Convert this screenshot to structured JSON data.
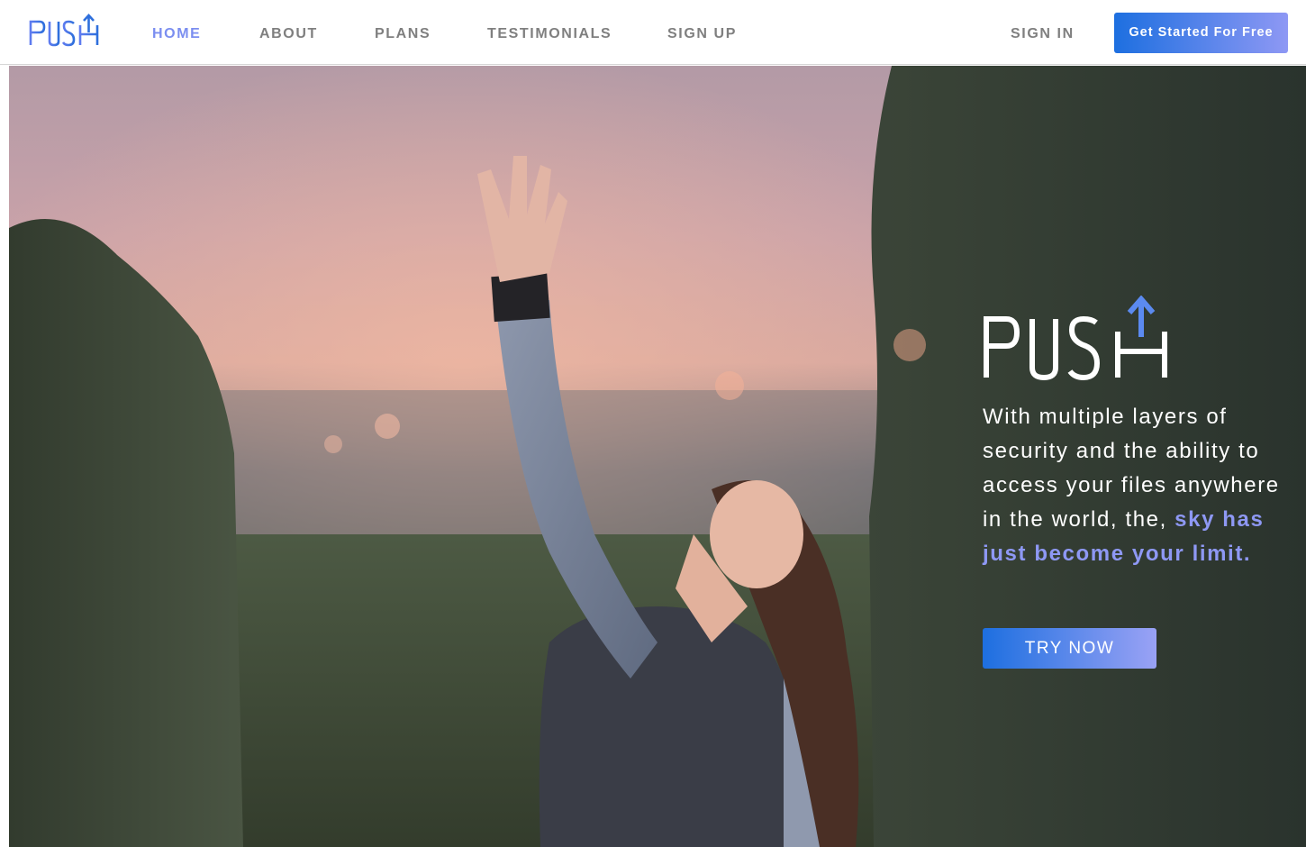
{
  "brand": {
    "logo_text": "PUSH"
  },
  "nav": {
    "items": [
      {
        "label": "HOME",
        "active": true
      },
      {
        "label": "ABOUT",
        "active": false
      },
      {
        "label": "PLANS",
        "active": false
      },
      {
        "label": "TESTIMONIALS",
        "active": false
      },
      {
        "label": "SIGN UP",
        "active": false
      }
    ],
    "sign_in": "SIGN IN",
    "cta": "Get Started For Free"
  },
  "hero": {
    "logo_text": "PUSH",
    "text_before": "With multiple layers of security and the ability to access your files anywhere in the world, the, ",
    "text_highlight": "sky has just become your limit.",
    "button": "TRY NOW"
  },
  "colors": {
    "accent": "#7b8ef0",
    "button_start": "#1d6fe0",
    "button_end": "#8e98f4",
    "nav_text": "#7f7f7f"
  }
}
